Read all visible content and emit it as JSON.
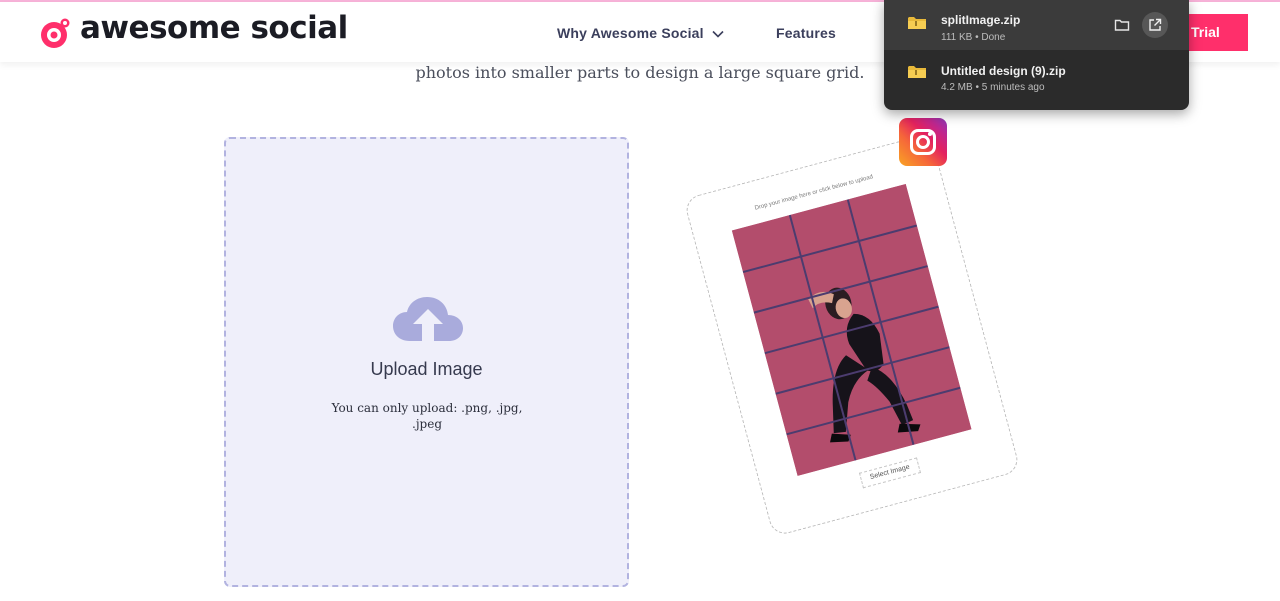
{
  "header": {
    "brand": "awesome social",
    "nav": {
      "why": "Why Awesome Social",
      "features": "Features"
    },
    "cta_label": "Trial"
  },
  "hero": {
    "subtitle": "photos into smaller parts to design a large square grid."
  },
  "upload": {
    "title": "Upload Image",
    "note": "You can only upload: .png, .jpg, .jpeg"
  },
  "illustration": {
    "caption": "Drop your image here or click below to upload",
    "button_label": "Select Image"
  },
  "downloads": [
    {
      "name": "splitImage.zip",
      "meta": "111 KB • Done"
    },
    {
      "name": "Untitled design (9).zip",
      "meta": "4.2 MB • 5 minutes ago"
    }
  ],
  "colors": {
    "brand_pink": "#ff2f6b",
    "dropzone_bg": "#efeffa",
    "dropzone_border": "#b2b3e0",
    "upload_icon": "#a9abdc",
    "popup_bg": "#2b2b2b"
  },
  "icons": {
    "logo": "awesome-social-logo-icon",
    "chevron": "chevron-down-icon",
    "upload": "cloud-upload-icon",
    "instagram": "instagram-icon",
    "folder": "zip-folder-icon",
    "show_in_folder": "show-in-folder-icon",
    "open_external": "open-external-icon"
  }
}
